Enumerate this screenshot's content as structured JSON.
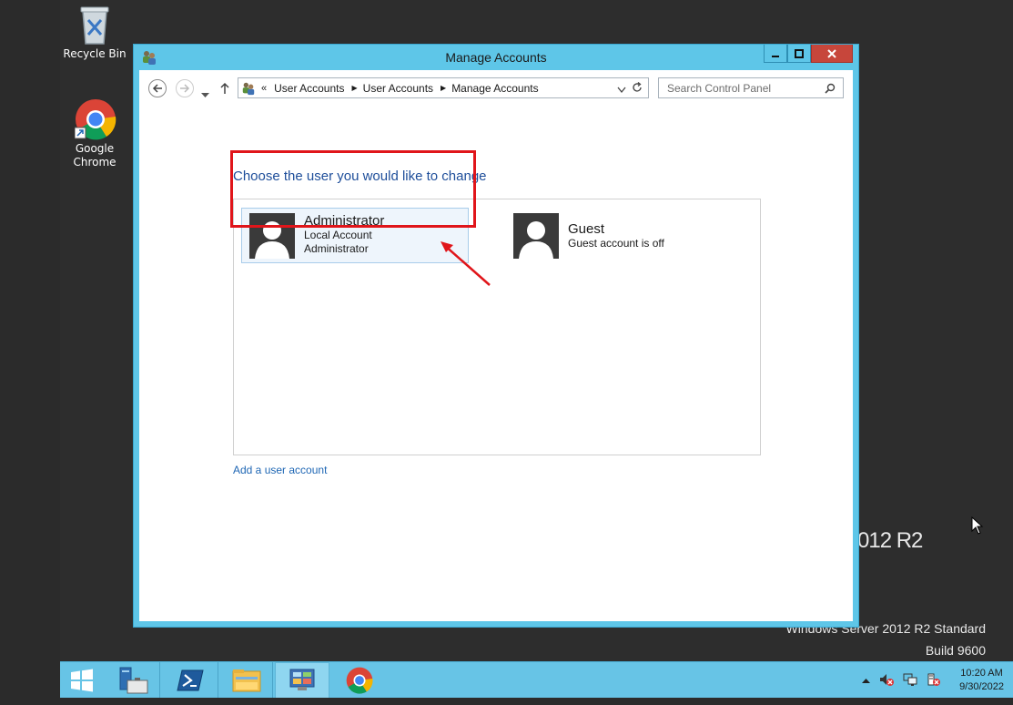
{
  "desktop": {
    "icons": [
      {
        "label": "Recycle Bin"
      },
      {
        "label_line1": "Google",
        "label_line2": "Chrome"
      }
    ],
    "watermark": {
      "big": "012 R2",
      "edition": "Windows Server 2012 R2 Standard",
      "build": "Build 9600"
    }
  },
  "window": {
    "title": "Manage Accounts",
    "address": {
      "overflow": "«",
      "crumbs": [
        "User Accounts",
        "User Accounts",
        "Manage Accounts"
      ]
    },
    "search_placeholder": "Search Control Panel",
    "heading": "Choose the user you would like to change",
    "accounts": [
      {
        "name": "Administrator",
        "line1": "Local Account",
        "line2": "Administrator"
      },
      {
        "name": "Guest",
        "line1": "Guest account is off"
      }
    ],
    "add_link": "Add a user account"
  },
  "taskbar": {
    "clock_time": "10:20 AM",
    "clock_date": "9/30/2022"
  },
  "colors": {
    "accent": "#5ec6e8",
    "highlight": "#e0151a",
    "link": "#1e66b4"
  }
}
